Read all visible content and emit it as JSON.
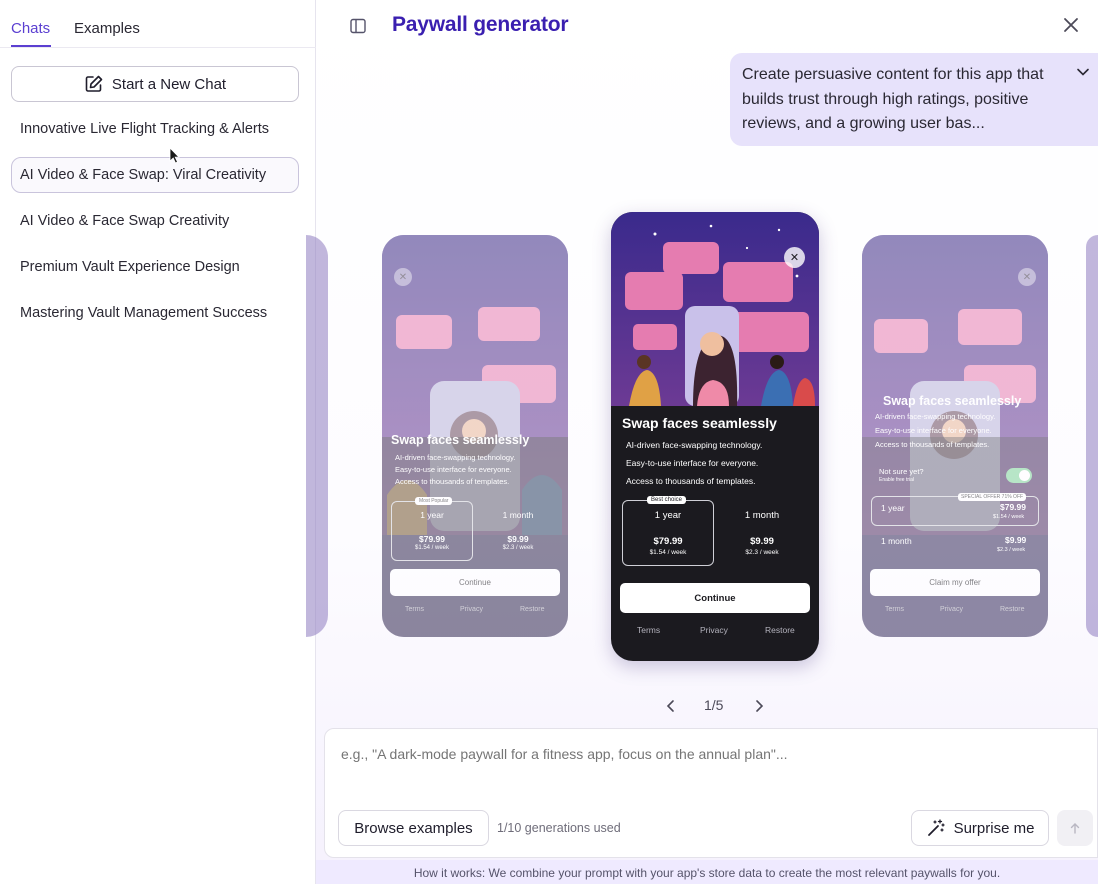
{
  "sidebar": {
    "tabs": [
      {
        "label": "Chats",
        "active": true
      },
      {
        "label": "Examples",
        "active": false
      }
    ],
    "new_chat_label": "Start a New Chat",
    "chats": [
      {
        "label": "Innovative Live Flight Tracking & Alerts"
      },
      {
        "label": "AI Video & Face Swap: Viral Creativity"
      },
      {
        "label": "AI Video & Face Swap Creativity"
      },
      {
        "label": "Premium Vault Experience Design"
      },
      {
        "label": "Mastering Vault Management Success"
      }
    ]
  },
  "header": {
    "title": "Paywall generator"
  },
  "prompt_bubble": {
    "text": "Create persuasive content for this app that builds trust through high ratings, positive reviews, and a growing user bas..."
  },
  "paywalls": {
    "left": {
      "title": "Swap faces seamlessly",
      "features": [
        "AI-driven face-swapping technology.",
        "Easy-to-use interface for everyone.",
        "Access to thousands of templates."
      ],
      "badge": "Most Popular",
      "plans": [
        {
          "label": "1 year",
          "price": "$79.99",
          "per": "$1.54 / week"
        },
        {
          "label": "1 month",
          "price": "$9.99",
          "per": "$2.3 / week"
        }
      ],
      "button": "Continue",
      "links": [
        "Terms",
        "Privacy",
        "Restore"
      ]
    },
    "center": {
      "title": "Swap faces seamlessly",
      "features": [
        "AI-driven face-swapping technology.",
        "Easy-to-use interface for everyone.",
        "Access to thousands of templates."
      ],
      "badge": "Best choice",
      "plans": [
        {
          "label": "1 year",
          "price": "$79.99",
          "per": "$1.54 / week"
        },
        {
          "label": "1 month",
          "price": "$9.99",
          "per": "$2.3 / week"
        }
      ],
      "button": "Continue",
      "links": [
        "Terms",
        "Privacy",
        "Restore"
      ]
    },
    "right": {
      "title": "Swap faces seamlessly",
      "features": [
        "AI-driven face-swapping technology.",
        "Easy-to-use interface for everyone.",
        "Access to thousands of templates."
      ],
      "toggle_label": "Not sure yet?",
      "toggle_sub": "Enable free trial",
      "badge": "SPECIAL OFFER 71% OFF",
      "plans": [
        {
          "label": "1 year",
          "price": "$79.99",
          "per": "$1.54 / week"
        },
        {
          "label": "1 month",
          "price": "$9.99",
          "per": "$2.3 / week"
        }
      ],
      "button": "Claim my offer",
      "links": [
        "Terms",
        "Privacy",
        "Restore"
      ]
    }
  },
  "pager": {
    "label": "1/5"
  },
  "composer": {
    "placeholder": "e.g., \"A dark-mode paywall for a fitness app, focus on the annual plan\"...",
    "browse_label": "Browse examples",
    "usage": "1/10 generations used",
    "surprise_label": "Surprise me"
  },
  "footer": {
    "how_it_works": "How it works: We combine your prompt with your app's store data to create the most relevant paywalls for you."
  },
  "colors": {
    "accent": "#5b3fd1",
    "title": "#3a1fb0",
    "bubble": "#e7e2fb",
    "paywall_bg": "#1b1a1f"
  }
}
